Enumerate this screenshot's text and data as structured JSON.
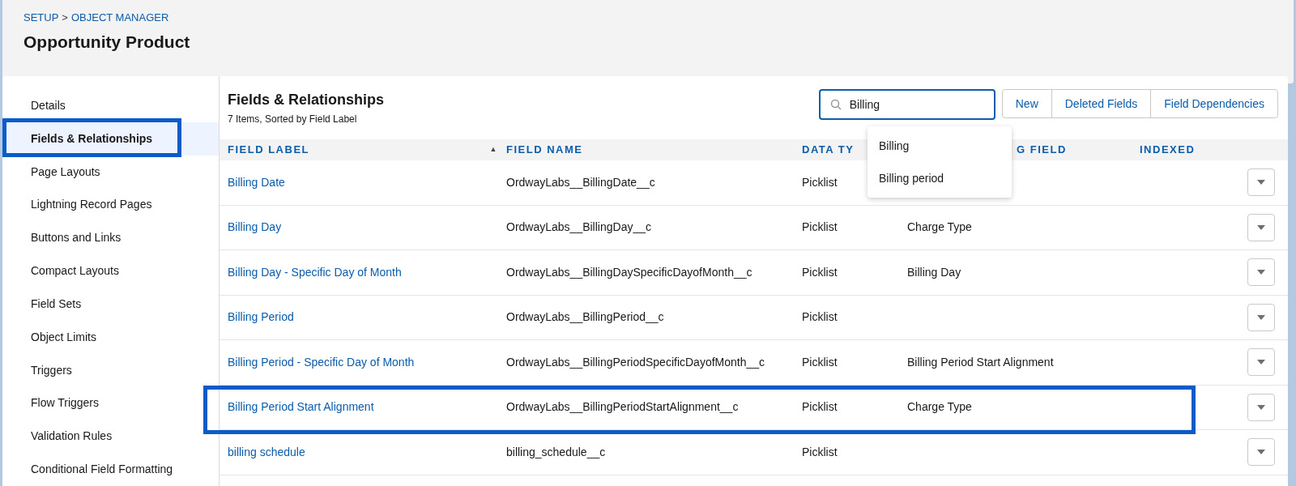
{
  "breadcrumb": {
    "items": [
      "SETUP",
      "OBJECT MANAGER"
    ],
    "separator": ">"
  },
  "title": "Opportunity Product",
  "sidebar": {
    "items": [
      {
        "label": "Details",
        "selected": false
      },
      {
        "label": "Fields & Relationships",
        "selected": true,
        "highlighted": true
      },
      {
        "label": "Page Layouts",
        "selected": false
      },
      {
        "label": "Lightning Record Pages",
        "selected": false
      },
      {
        "label": "Buttons and Links",
        "selected": false
      },
      {
        "label": "Compact Layouts",
        "selected": false
      },
      {
        "label": "Field Sets",
        "selected": false
      },
      {
        "label": "Object Limits",
        "selected": false
      },
      {
        "label": "Triggers",
        "selected": false
      },
      {
        "label": "Flow Triggers",
        "selected": false
      },
      {
        "label": "Validation Rules",
        "selected": false
      },
      {
        "label": "Conditional Field Formatting",
        "selected": false
      }
    ]
  },
  "section": {
    "title": "Fields & Relationships",
    "subtitle": "7 Items, Sorted by Field Label"
  },
  "search": {
    "value": "Billing",
    "suggestions": [
      "Billing",
      "Billing period"
    ]
  },
  "buttons": [
    "New",
    "Deleted Fields",
    "Field Dependencies"
  ],
  "table": {
    "columns": [
      {
        "label": "FIELD LABEL",
        "sort": "▲"
      },
      {
        "label": "FIELD NAME"
      },
      {
        "label": "DATA TY"
      },
      {
        "label": "G FIELD"
      },
      {
        "label": "INDEXED"
      }
    ],
    "rows": [
      {
        "label": "Billing Date",
        "name": "OrdwayLabs__BillingDate__c",
        "type": "Picklist",
        "controlling": "",
        "highlighted": false
      },
      {
        "label": "Billing Day",
        "name": "OrdwayLabs__BillingDay__c",
        "type": "Picklist",
        "controlling": "Charge Type",
        "highlighted": false
      },
      {
        "label": "Billing Day - Specific Day of Month",
        "name": "OrdwayLabs__BillingDaySpecificDayofMonth__c",
        "type": "Picklist",
        "controlling": "Billing Day",
        "highlighted": false
      },
      {
        "label": "Billing Period",
        "name": "OrdwayLabs__BillingPeriod__c",
        "type": "Picklist",
        "controlling": "",
        "highlighted": false
      },
      {
        "label": "Billing Period - Specific Day of Month",
        "name": "OrdwayLabs__BillingPeriodSpecificDayofMonth__c",
        "type": "Picklist",
        "controlling": "Billing Period Start Alignment",
        "highlighted": false
      },
      {
        "label": "Billing Period Start Alignment",
        "name": "OrdwayLabs__BillingPeriodStartAlignment__c",
        "type": "Picklist",
        "controlling": "Charge Type",
        "highlighted": true
      },
      {
        "label": "billing schedule",
        "name": "billing_schedule__c",
        "type": "Picklist",
        "controlling": "",
        "highlighted": false
      }
    ]
  }
}
